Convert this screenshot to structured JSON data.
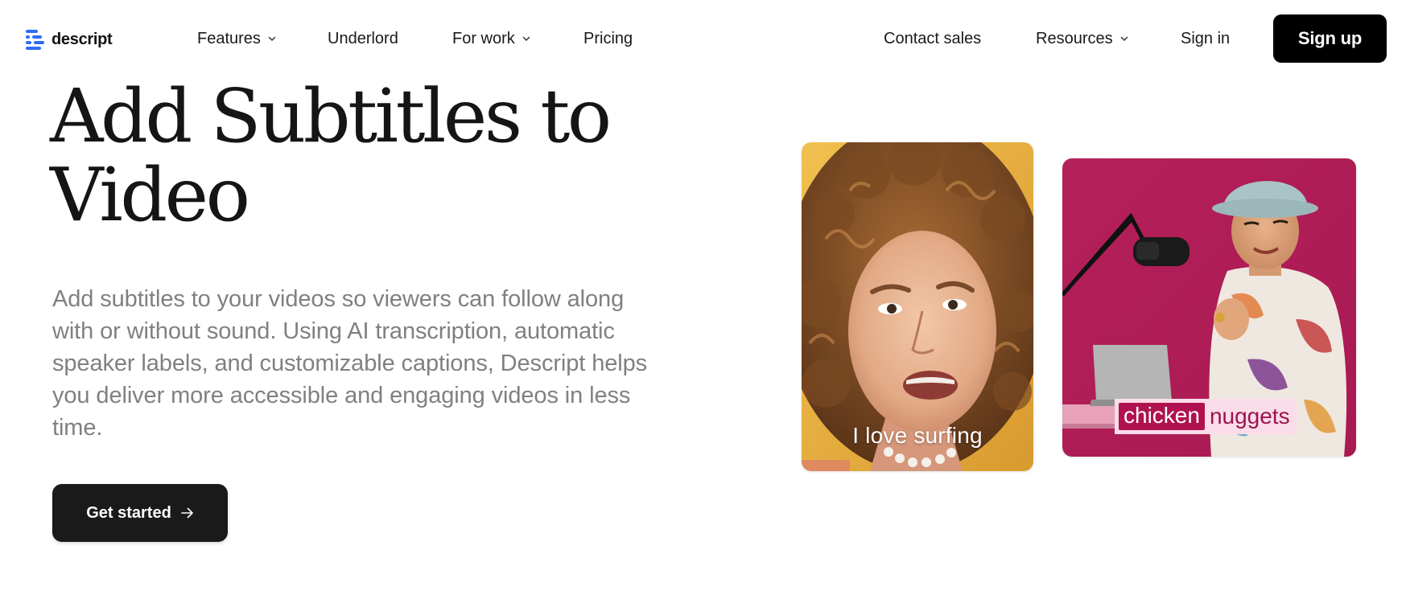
{
  "brand": {
    "name": "descript",
    "color": "#2f6df6"
  },
  "nav": {
    "features": "Features",
    "underlord": "Underlord",
    "for_work": "For work",
    "pricing": "Pricing",
    "contact_sales": "Contact sales",
    "resources": "Resources",
    "sign_in": "Sign in",
    "sign_up": "Sign up"
  },
  "hero": {
    "title_line1": "Add Subtitles to",
    "title_line2": "Video",
    "subtitle": "Add subtitles to your videos so viewers can follow along with or without sound. Using AI transcription, automatic speaker labels, and customizable captions, Descript helps you deliver more accessible and engaging videos in less time.",
    "cta": "Get started"
  },
  "videos": {
    "card1_caption": "I love surfing",
    "card2_caption_highlight": "chicken",
    "card2_caption_rest": "nuggets"
  },
  "colors": {
    "black": "#000000",
    "text_muted": "#808080",
    "card1_bg": "#e8b24a",
    "card2_bg": "#b21e58",
    "caption_highlight": "#b0124f",
    "caption_box": "#fbdce9"
  }
}
